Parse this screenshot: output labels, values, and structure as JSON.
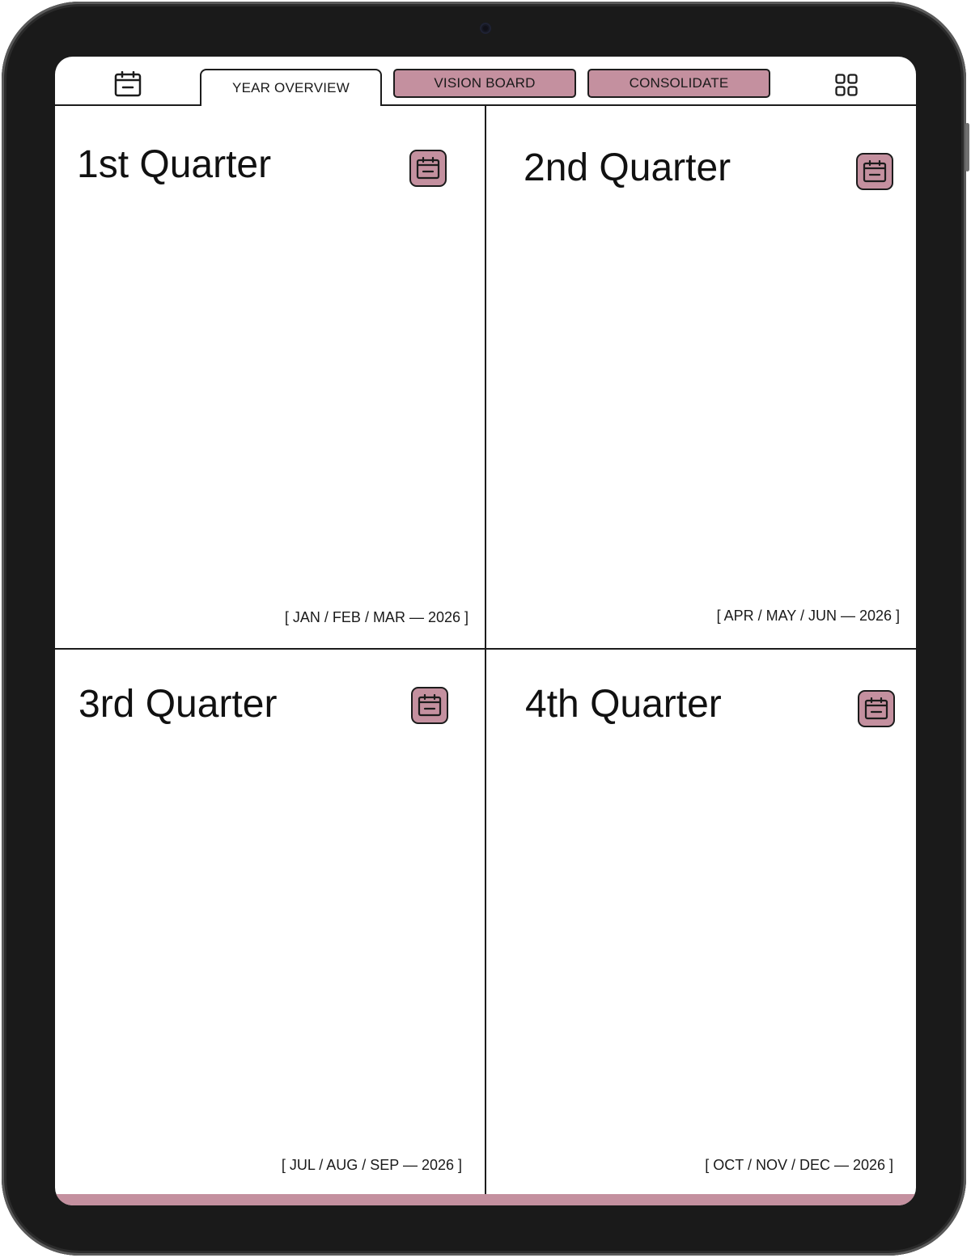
{
  "tabs": [
    {
      "label": "YEAR OVERVIEW",
      "active": true
    },
    {
      "label": "VISION BOARD",
      "active": false
    },
    {
      "label": "CONSOLIDATE",
      "active": false
    }
  ],
  "nav_icons": {
    "left": "calendar-icon",
    "right": "grid-icon"
  },
  "quarters": [
    {
      "title": "1st Quarter",
      "range": "[ JAN / FEB / MAR — 2026 ]"
    },
    {
      "title": "2nd Quarter",
      "range": "[ APR / MAY / JUN — 2026 ]"
    },
    {
      "title": "3rd Quarter",
      "range": "[ JUL / AUG / SEP — 2026 ]"
    },
    {
      "title": "4th Quarter",
      "range": "[ OCT / NOV / DEC — 2026 ]"
    }
  ],
  "colors": {
    "accent": "#c4909f",
    "line": "#1c1c1c",
    "frame": "#1a1a1a",
    "paper": "#ffffff"
  }
}
